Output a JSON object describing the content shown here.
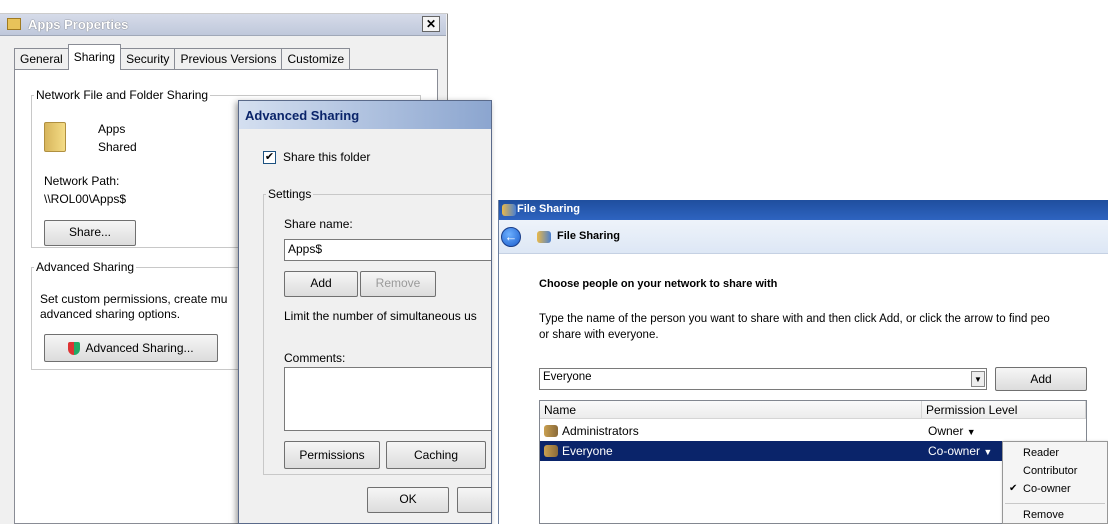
{
  "props": {
    "title": "Apps Properties",
    "tabs": [
      "General",
      "Sharing",
      "Security",
      "Previous Versions",
      "Customize"
    ],
    "net_group": "Network File and Folder Sharing",
    "folder_name": "Apps",
    "folder_status": "Shared",
    "path_label": "Network Path:",
    "path_value": "\\\\ROL00\\Apps$",
    "share_btn": "Share...",
    "adv_group": "Advanced Sharing",
    "adv_desc1": "Set custom permissions, create mu",
    "adv_desc2": "advanced sharing options.",
    "adv_btn": "Advanced Sharing..."
  },
  "adv": {
    "title": "Advanced Sharing",
    "share_check_label": "Share this folder",
    "settings_group": "Settings",
    "share_name_label": "Share name:",
    "share_name_value": "Apps$",
    "add_btn": "Add",
    "remove_btn": "Remove",
    "limit_label": "Limit the number of simultaneous us",
    "comments_label": "Comments:",
    "permissions_btn": "Permissions",
    "caching_btn": "Caching",
    "ok_btn": "OK"
  },
  "fs": {
    "window_title": "File Sharing",
    "nav_title": "File Sharing",
    "heading": "Choose people on your network to share with",
    "desc1": "Type the name of the person you want to share with and then click Add, or click the arrow to find peo",
    "desc2": "or share with everyone.",
    "input_value": "Everyone",
    "add_btn": "Add",
    "col_name": "Name",
    "col_perm": "Permission Level",
    "rows": [
      {
        "name": "Administrators",
        "perm": "Owner"
      },
      {
        "name": "Everyone",
        "perm": "Co-owner"
      }
    ],
    "menu": [
      "Reader",
      "Contributor",
      "Co-owner",
      "Remove"
    ],
    "menu_checked": "Co-owner"
  },
  "colors": {
    "selection": "#0a246a",
    "title_blue": "#1f4e9e"
  }
}
